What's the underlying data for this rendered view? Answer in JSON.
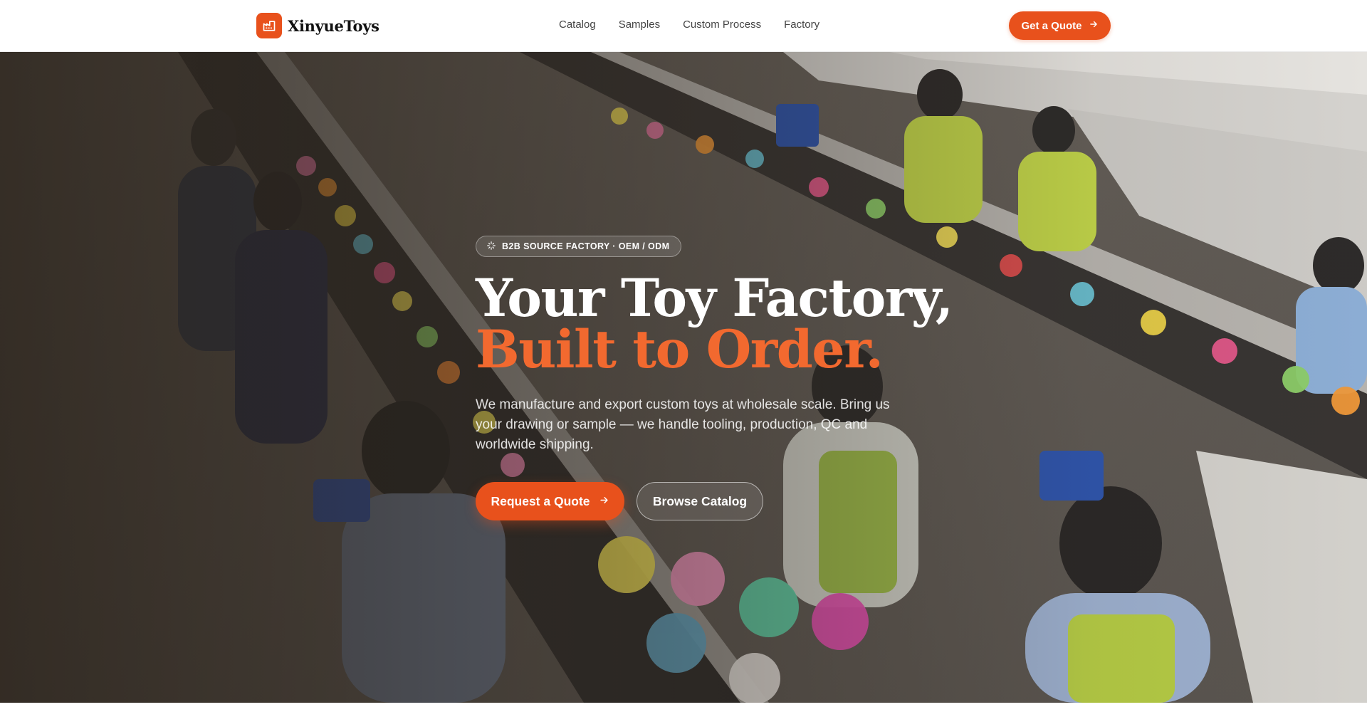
{
  "brand": {
    "name": "XinyueToys",
    "logo_icon": "factory-icon",
    "accent_color": "#e8511c"
  },
  "nav": {
    "items": [
      {
        "label": "Catalog"
      },
      {
        "label": "Samples"
      },
      {
        "label": "Custom Process"
      },
      {
        "label": "Factory"
      }
    ]
  },
  "header": {
    "cta_label": "Get a Quote",
    "cta_icon": "arrow-right-icon"
  },
  "hero": {
    "background": "factory-production-line-photo",
    "badge": {
      "icon": "sparkle-icon",
      "label": "B2B SOURCE FACTORY · OEM / ODM"
    },
    "headline_line1": "Your Toy Factory,",
    "headline_line2": "Built to Order.",
    "headline_accent_color": "#f2692f",
    "subtext": "We manufacture and export custom toys at wholesale scale. Bring us your drawing or sample — we handle tooling, production, QC and worldwide shipping.",
    "primary_cta": {
      "label": "Request a Quote",
      "icon": "arrow-right-icon"
    },
    "secondary_cta": {
      "label": "Browse Catalog"
    }
  }
}
